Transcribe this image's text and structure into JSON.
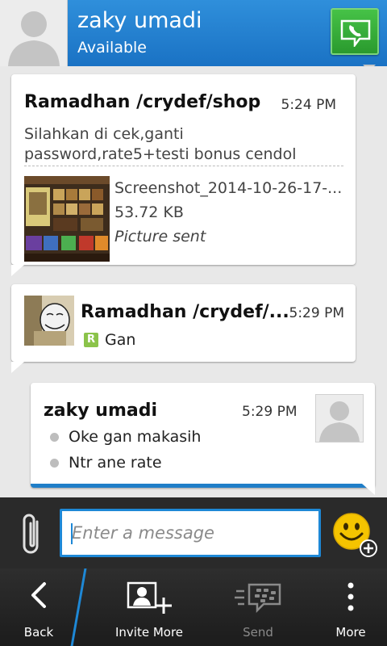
{
  "header": {
    "contact_name": "zaky umadi",
    "status": "Available"
  },
  "messages": [
    {
      "sender": "Ramadhan /crydef/shop",
      "time": "5:24 PM",
      "text": "Silahkan di cek,ganti password,rate5+testi bonus cendol",
      "attachment": {
        "file_name": "Screenshot_2014-10-26-17-...",
        "size": "53.72 KB",
        "status": "Picture sent"
      }
    },
    {
      "sender": "Ramadhan /crydef/...",
      "time": "5:29 PM",
      "badge": "R",
      "text": "Gan"
    },
    {
      "sender": "zaky umadi",
      "time": "5:29 PM",
      "lines": [
        "Oke gan makasih",
        "Ntr ane rate"
      ]
    }
  ],
  "composer": {
    "placeholder": "Enter a message"
  },
  "actions": {
    "back": "Back",
    "invite": "Invite More",
    "send": "Send",
    "more": "More"
  },
  "colors": {
    "header_blue": "#1a72c4",
    "accent_blue": "#1e88d6",
    "call_green": "#2a9a2e",
    "emoji_yellow": "#f5c400"
  }
}
